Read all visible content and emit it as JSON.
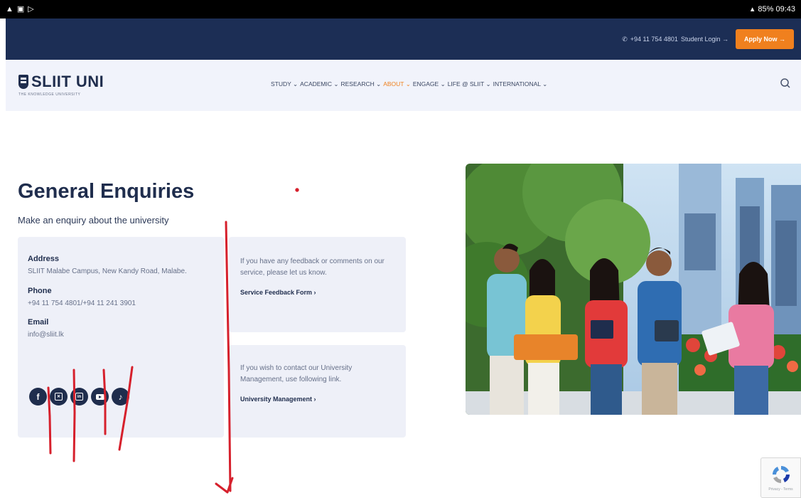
{
  "status_bar": {
    "left_icons": [
      "warning-icon",
      "gallery-icon",
      "media-icon"
    ],
    "right": "85% 09:43"
  },
  "top_bar": {
    "phone_text": "+94 11 754 4801",
    "student_login": "Student Login →",
    "apply_label": "Apply Now →"
  },
  "logo": {
    "text": "SLIIT UNI",
    "subtext": "THE KNOWLEDGE UNIVERSITY"
  },
  "menu": {
    "items": [
      {
        "label": "STUDY ⌄"
      },
      {
        "label": "ACADEMIC ⌄"
      },
      {
        "label": "RESEARCH ⌄"
      },
      {
        "label": "ABOUT ⌄"
      },
      {
        "label": "ENGAGE ⌄"
      },
      {
        "label": "LIFE @ SLIIT ⌄"
      },
      {
        "label": "INTERNATIONAL ⌄"
      }
    ],
    "active_index": 3
  },
  "page": {
    "title": "General Enquiries",
    "subtitle": "Make an enquiry about the university"
  },
  "contact": {
    "address_label": "Address",
    "address_value": "SLIIT Malabe Campus, New Kandy Road, Malabe.",
    "phone_label": "Phone",
    "phone_value": "+94 11 754 4801/+94 11 241 3901",
    "email_label": "Email",
    "email_value": "info@sliit.lk"
  },
  "socials": [
    "facebook-icon",
    "x-icon",
    "linkedin-icon",
    "youtube-icon",
    "tiktok-icon"
  ],
  "feedback": {
    "text": "If you have any feedback or comments on our service, please let us know.",
    "link": "Service Feedback Form ›"
  },
  "management": {
    "text": "If you wish to contact our University Management, use following link.",
    "link": "University Management ›"
  },
  "colors": {
    "navy": "#1c2e55",
    "accent": "#f0801e",
    "card_bg": "#eef0f8",
    "annotation": "#d6202c"
  }
}
